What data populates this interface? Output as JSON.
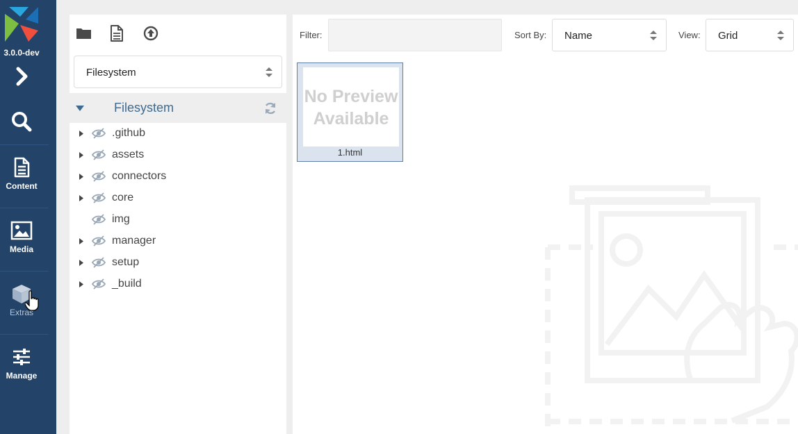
{
  "app": {
    "version": "3.0.0-dev"
  },
  "nav": {
    "items": [
      {
        "label": "Content",
        "icon": "document-icon"
      },
      {
        "label": "Media",
        "icon": "image-icon"
      },
      {
        "label": "Extras",
        "icon": "cube-icon"
      },
      {
        "label": "Manage",
        "icon": "sliders-icon"
      }
    ]
  },
  "tree": {
    "toolbar": [
      "folder-icon",
      "new-file-icon",
      "upload-icon"
    ],
    "source": "Filesystem",
    "root": "Filesystem",
    "items": [
      {
        "name": ".github",
        "expandable": true
      },
      {
        "name": "assets",
        "expandable": true
      },
      {
        "name": "connectors",
        "expandable": true
      },
      {
        "name": "core",
        "expandable": true
      },
      {
        "name": "img",
        "expandable": false
      },
      {
        "name": "manager",
        "expandable": true
      },
      {
        "name": "setup",
        "expandable": true
      },
      {
        "name": "_build",
        "expandable": true
      }
    ]
  },
  "browser": {
    "filter_label": "Filter:",
    "filter_value": "",
    "sort_label": "Sort By:",
    "sort_value": "Name",
    "view_label": "View:",
    "view_value": "Grid",
    "files": [
      {
        "name": "1.html",
        "preview_line1": "No Preview",
        "preview_line2": "Available"
      }
    ]
  },
  "colors": {
    "nav_bg": "#234368",
    "accent": "#3e6a8f",
    "selected_bg": "#dbe3ee"
  }
}
